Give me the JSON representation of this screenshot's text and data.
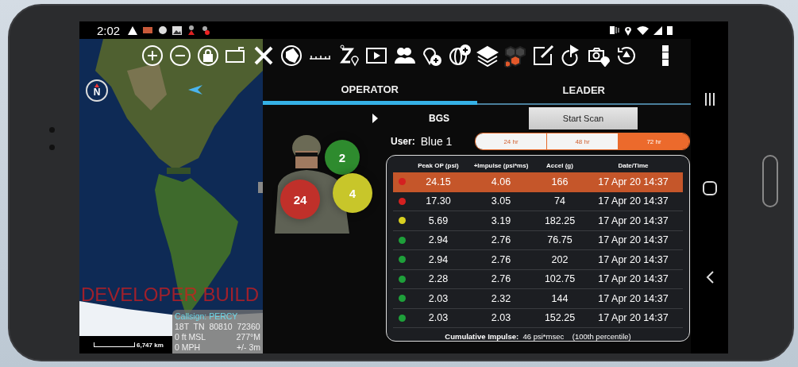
{
  "status_bar": {
    "time": "2:02"
  },
  "map": {
    "compass": "N",
    "scale": "6,747 km",
    "overlay": "DEVELOPER BUILD",
    "info": {
      "callsign": "Callsign: PERCY",
      "grid": "18T  TN  80810  72360",
      "altitude": "0 ft MSL",
      "heading": "277°M",
      "speed": "0 MPH",
      "accuracy": "+/- 3m"
    }
  },
  "tabs": [
    {
      "label": "OPERATOR",
      "selected": true
    },
    {
      "label": "LEADER",
      "selected": false
    }
  ],
  "soldier": {
    "markers": [
      {
        "value": "2",
        "color": "#2e8b2e"
      },
      {
        "value": "4",
        "color": "#c8c62a"
      },
      {
        "value": "24",
        "color": "#c0302a"
      }
    ]
  },
  "device": {
    "name": "BGS",
    "scan_button": "Start Scan",
    "user_label": "User:",
    "user": "Blue 1"
  },
  "periods": [
    {
      "label": "24 hr",
      "selected": false
    },
    {
      "label": "48 hr",
      "selected": false
    },
    {
      "label": "72 hr",
      "selected": true
    }
  ],
  "table": {
    "columns": [
      "Peak OP (psi)",
      "+Impulse (psi*ms)",
      "Accel (g)",
      "Date/Time"
    ],
    "rows": [
      {
        "color": "#d42020",
        "selected": true,
        "cells": [
          "24.15",
          "4.06",
          "166",
          "17 Apr 20 14:37"
        ]
      },
      {
        "color": "#d42020",
        "selected": false,
        "cells": [
          "17.30",
          "3.05",
          "74",
          "17 Apr 20 14:37"
        ]
      },
      {
        "color": "#d8d020",
        "selected": false,
        "cells": [
          "5.69",
          "3.19",
          "182.25",
          "17 Apr 20 14:37"
        ]
      },
      {
        "color": "#1ea03a",
        "selected": false,
        "cells": [
          "2.94",
          "2.76",
          "76.75",
          "17 Apr 20 14:37"
        ]
      },
      {
        "color": "#1ea03a",
        "selected": false,
        "cells": [
          "2.94",
          "2.76",
          "202",
          "17 Apr 20 14:37"
        ]
      },
      {
        "color": "#1ea03a",
        "selected": false,
        "cells": [
          "2.28",
          "2.76",
          "102.75",
          "17 Apr 20 14:37"
        ]
      },
      {
        "color": "#1ea03a",
        "selected": false,
        "cells": [
          "2.03",
          "2.32",
          "144",
          "17 Apr 20 14:37"
        ]
      },
      {
        "color": "#1ea03a",
        "selected": false,
        "cells": [
          "2.03",
          "2.03",
          "152.25",
          "17 Apr 20 14:37"
        ]
      }
    ],
    "footer": "**Cumulative Impulse:**  46 psi*msec    (100th percentile)"
  }
}
